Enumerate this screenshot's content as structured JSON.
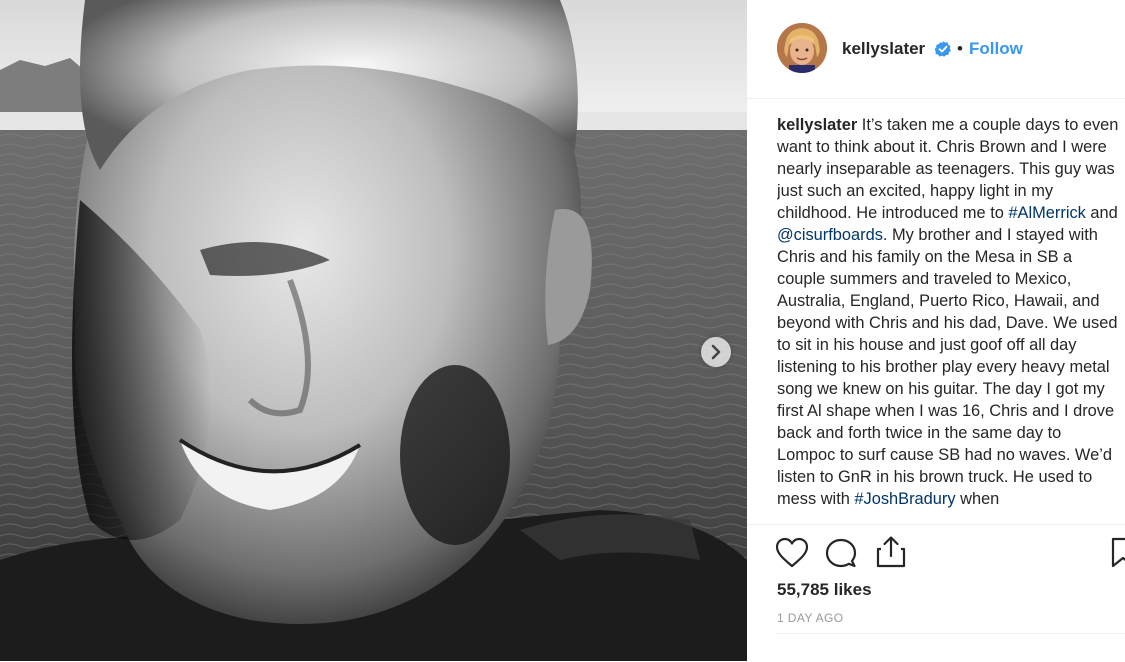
{
  "header": {
    "username": "kellyslater",
    "verified_icon": "verified-badge-icon",
    "separator": "•",
    "follow_label": "Follow"
  },
  "caption": {
    "username": "kellyslater",
    "segments": [
      {
        "type": "text",
        "value": "It’s taken me a couple days to even want to think about it. Chris Brown and I were nearly inseparable as teenagers. This guy was just such an excited, happy light in my childhood. He introduced me to "
      },
      {
        "type": "link",
        "value": "#AlMerrick"
      },
      {
        "type": "text",
        "value": " and "
      },
      {
        "type": "link",
        "value": "@cisurfboards"
      },
      {
        "type": "text",
        "value": ". My brother and I stayed with Chris and his family on the Mesa in SB a couple summers and traveled to Mexico, Australia, England, Puerto Rico, Hawaii, and beyond with Chris and his dad, Dave. We used to sit in his house and just goof off all day listening to his brother play every heavy metal song we knew on his guitar. The day I got my first Al shape when I was 16, Chris and I drove back and forth twice in the same day to Lompoc to surf cause SB had no waves. We’d listen to GnR in his brown truck. He used to mess with "
      },
      {
        "type": "link",
        "value": "#JoshBradury"
      },
      {
        "type": "text",
        "value": " when"
      }
    ]
  },
  "actions": {
    "icons": [
      "heart-icon",
      "comment-icon",
      "share-icon",
      "bookmark-icon"
    ],
    "likes": "55,785 likes",
    "time_ago": "1 DAY AGO"
  },
  "media": {
    "next_icon": "chevron-right-icon"
  },
  "colors": {
    "link": "#003569",
    "follow": "#3897f0",
    "verified": "#3897f0",
    "text": "#262626",
    "muted": "#999999"
  }
}
